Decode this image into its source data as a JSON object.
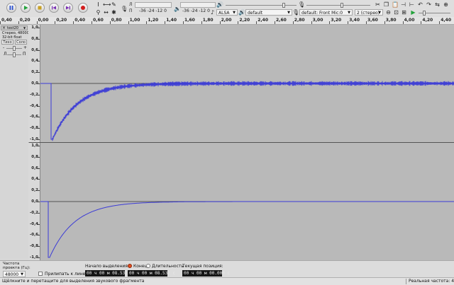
{
  "ruler": {
    "ticks": [
      "0,40",
      "0,20",
      "0,00",
      "0,20",
      "0,40",
      "0,60",
      "0,80",
      "1,00",
      "1,20",
      "1,40",
      "1,60",
      "1,80",
      "2,00",
      "2,20",
      "2,40",
      "2,60",
      "2,80",
      "3,00",
      "3,20",
      "3,40",
      "3,60",
      "3,80",
      "4,00",
      "4,20",
      "4,40"
    ]
  },
  "toolbar": {
    "pause": "pause-icon",
    "play": "play-icon",
    "stop": "stop-icon",
    "skip_start": "skip-start-icon",
    "skip_end": "skip-end-icon",
    "record": "record-icon",
    "rec_meter_l": "Л",
    "rec_meter_r": "П",
    "rec_meter_scale": "-36 -24 -12 0",
    "play_meter_scale": "-36 -24 -12 0",
    "host": "ALSA",
    "output_device": "default",
    "input_device": "default: Front Mic:0",
    "channels": "2 (стерео)"
  },
  "track": {
    "name": "test20",
    "info_line1": "Стерео, 48000Hz",
    "info_line2": "32-bit float",
    "mute": "Тихо",
    "solo": "Соло",
    "pan_l": "Л",
    "pan_r": "П",
    "minus": "-",
    "plus": "+"
  },
  "vscale": [
    "1,0",
    "0,8",
    "0,6",
    "0,4",
    "0,2",
    "0,0",
    "-0,2",
    "-0,4",
    "-0,6",
    "-0,8",
    "-1,0"
  ],
  "bottom": {
    "project_rate_label": "Частота проекта (Гц):",
    "project_rate": "48000",
    "snap_label": "Прилипать к линейке",
    "selection_start_label": "Начало выделения:",
    "end_label": "Конец",
    "length_label": "Длительность",
    "position_label": "Текущая позиция:",
    "start_time": "00 ч 00 м 08.532 с",
    "end_time": "00 ч 00 м 08.532 с",
    "position_time": "00 ч 00 м 00.000 с"
  },
  "status": {
    "hint": "Щёлкните и перетащите для выделения звукового фрагмента",
    "rate": "Реальная частота: 48000 Гц"
  },
  "colors": {
    "waveform": "#3b3bd6",
    "waveform_bg": "#b9b9b9"
  }
}
